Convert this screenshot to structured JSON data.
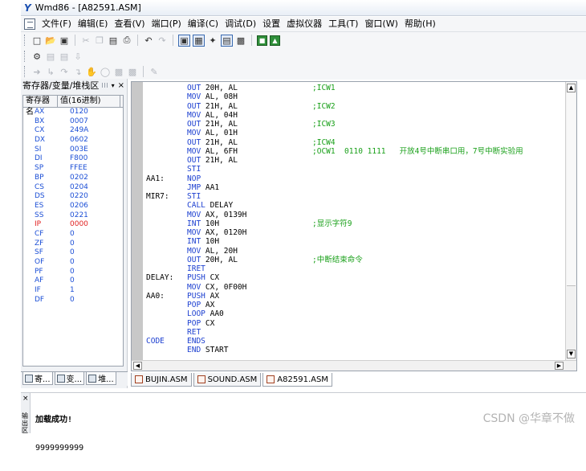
{
  "window": {
    "logo": "Y",
    "title": "Wmd86 - [A82591.ASM]"
  },
  "menu": [
    "文件(F)",
    "编辑(E)",
    "查看(V)",
    "端口(P)",
    "编译(C)",
    "调试(D)",
    "设置",
    "虚拟仪器",
    "工具(T)",
    "窗口(W)",
    "帮助(H)"
  ],
  "register_panel": {
    "title": "寄存器/变量/堆栈区",
    "columns": [
      "寄存器名",
      "值(16进制)"
    ],
    "registers": [
      {
        "name": "AX",
        "value": "0120"
      },
      {
        "name": "BX",
        "value": "0007"
      },
      {
        "name": "CX",
        "value": "249A"
      },
      {
        "name": "DX",
        "value": "0602"
      },
      {
        "name": "SI",
        "value": "003E"
      },
      {
        "name": "DI",
        "value": "F800"
      },
      {
        "name": "SP",
        "value": "FFEE"
      },
      {
        "name": "BP",
        "value": "0202"
      },
      {
        "name": "CS",
        "value": "0204"
      },
      {
        "name": "DS",
        "value": "0220"
      },
      {
        "name": "ES",
        "value": "0206"
      },
      {
        "name": "SS",
        "value": "0221"
      },
      {
        "name": "IP",
        "value": "0000"
      },
      {
        "name": "CF",
        "value": "0"
      },
      {
        "name": "ZF",
        "value": "0"
      },
      {
        "name": "SF",
        "value": "0"
      },
      {
        "name": "OF",
        "value": "0"
      },
      {
        "name": "PF",
        "value": "0"
      },
      {
        "name": "AF",
        "value": "0"
      },
      {
        "name": "IF",
        "value": "1"
      },
      {
        "name": "DF",
        "value": "0"
      }
    ],
    "highlight_color": "#e02020",
    "tabs": [
      "寄...",
      "变...",
      "堆..."
    ]
  },
  "code_lines": [
    {
      "label": "",
      "mnemonic": "OUT",
      "operand": "20H, AL",
      "comment": ";ICW1"
    },
    {
      "label": "",
      "mnemonic": "MOV",
      "operand": "AL, 08H",
      "comment": ""
    },
    {
      "label": "",
      "mnemonic": "OUT",
      "operand": "21H, AL",
      "comment": ";ICW2"
    },
    {
      "label": "",
      "mnemonic": "MOV",
      "operand": "AL, 04H",
      "comment": ""
    },
    {
      "label": "",
      "mnemonic": "OUT",
      "operand": "21H, AL",
      "comment": ";ICW3"
    },
    {
      "label": "",
      "mnemonic": "MOV",
      "operand": "AL, 01H",
      "comment": ""
    },
    {
      "label": "",
      "mnemonic": "OUT",
      "operand": "21H, AL",
      "comment": ";ICW4"
    },
    {
      "label": "",
      "mnemonic": "MOV",
      "operand": "AL, 6FH",
      "comment": ";OCW1  0110 1111   开放4号中断串口用，7号中断实验用"
    },
    {
      "label": "",
      "mnemonic": "OUT",
      "operand": "21H, AL",
      "comment": ""
    },
    {
      "label": "",
      "mnemonic": "STI",
      "operand": "",
      "comment": ""
    },
    {
      "label": "AA1:",
      "mnemonic": "NOP",
      "operand": "",
      "comment": ""
    },
    {
      "label": "",
      "mnemonic": "JMP",
      "operand": "AA1",
      "comment": ""
    },
    {
      "label": "MIR7:",
      "mnemonic": "STI",
      "operand": "",
      "comment": ""
    },
    {
      "label": "",
      "mnemonic": "CALL",
      "operand": "DELAY",
      "comment": ""
    },
    {
      "label": "",
      "mnemonic": "MOV",
      "operand": "AX, 0139H",
      "comment": ""
    },
    {
      "label": "",
      "mnemonic": "INT",
      "operand": "10H",
      "comment": ";显示字符9"
    },
    {
      "label": "",
      "mnemonic": "MOV",
      "operand": "AX, 0120H",
      "comment": ""
    },
    {
      "label": "",
      "mnemonic": "INT",
      "operand": "10H",
      "comment": ""
    },
    {
      "label": "",
      "mnemonic": "MOV",
      "operand": "AL, 20H",
      "comment": ""
    },
    {
      "label": "",
      "mnemonic": "OUT",
      "operand": "20H, AL",
      "comment": ";中断结束命令"
    },
    {
      "label": "",
      "mnemonic": "IRET",
      "operand": "",
      "comment": ""
    },
    {
      "label": "DELAY:",
      "mnemonic": "PUSH",
      "operand": "CX",
      "comment": ""
    },
    {
      "label": "",
      "mnemonic": "MOV",
      "operand": "CX, 0F00H",
      "comment": ""
    },
    {
      "label": "AA0:",
      "mnemonic": "PUSH",
      "operand": "AX",
      "comment": ""
    },
    {
      "label": "",
      "mnemonic": "POP",
      "operand": "AX",
      "comment": ""
    },
    {
      "label": "",
      "mnemonic": "LOOP",
      "operand": "AA0",
      "comment": ""
    },
    {
      "label": "",
      "mnemonic": "POP",
      "operand": "CX",
      "comment": ""
    },
    {
      "label": "",
      "mnemonic": "RET",
      "operand": "",
      "comment": ""
    },
    {
      "label": "CODE",
      "mnemonic": "ENDS",
      "operand": "",
      "comment": ""
    },
    {
      "label": "",
      "mnemonic": "END",
      "operand": "START",
      "comment": ""
    }
  ],
  "file_tabs": [
    {
      "name": "BUJIN.ASM",
      "active": false
    },
    {
      "name": "SOUND.ASM",
      "active": false
    },
    {
      "name": "A82591.ASM",
      "active": true
    }
  ],
  "output": {
    "side_label": "输出区",
    "lines": [
      "加载成功!",
      "9999999999"
    ]
  },
  "watermark": "CSDN @华章不做"
}
